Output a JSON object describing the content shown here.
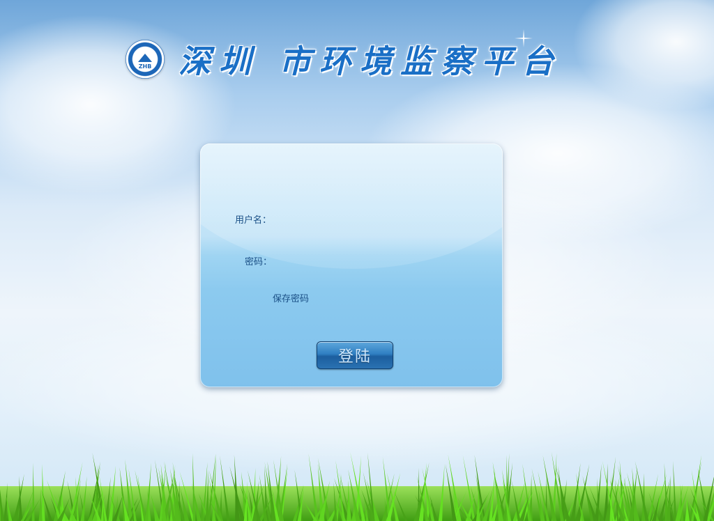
{
  "header": {
    "logo_text": "ZHB",
    "title": "深圳 市环境监察平台"
  },
  "login": {
    "username_label": "用户名：",
    "password_label": "密码：",
    "username_value": "",
    "password_value": "",
    "remember_label": "保存密码",
    "submit_label": "登陆"
  },
  "colors": {
    "title_blue": "#1a6fc6",
    "label_blue": "#1a4f86",
    "button_blue": "#2f7fc2",
    "grass_green": "#5cc21e"
  }
}
